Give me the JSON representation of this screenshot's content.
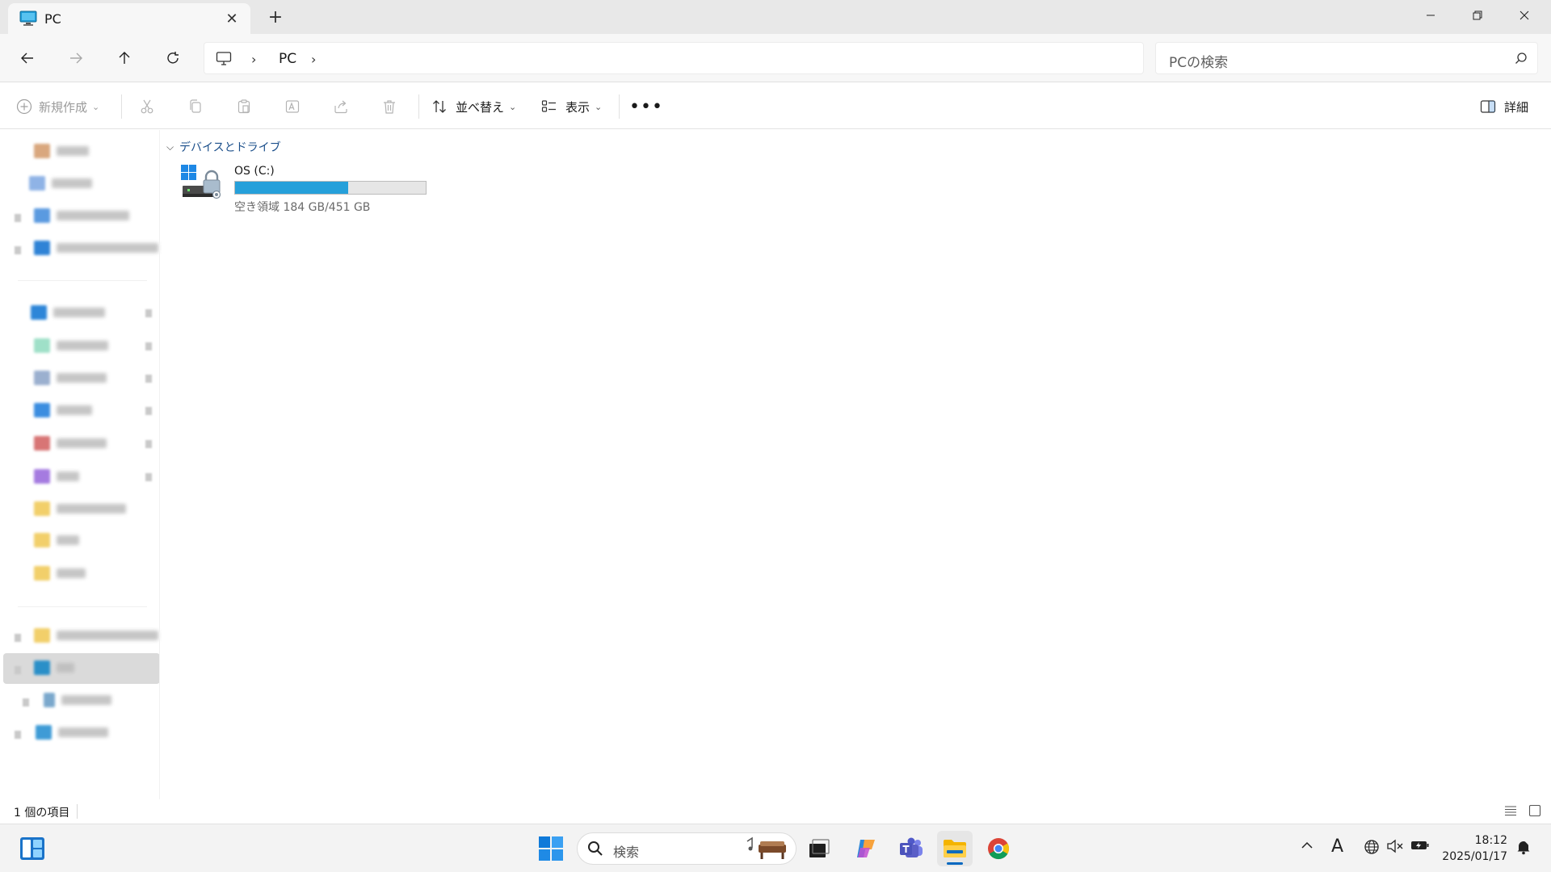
{
  "window": {
    "tab_title": "PC",
    "new_tab_glyph": "+",
    "close_tab_glyph": "✕"
  },
  "address": {
    "location_label": "PC",
    "separator": "›",
    "search_placeholder": "PCの検索"
  },
  "commandbar": {
    "new_label": "新規作成",
    "sort_label": "並べ替え",
    "view_label": "表示",
    "more_label": "•••",
    "details_label": "詳細"
  },
  "content": {
    "group_header": "デバイスとドライブ",
    "drives": [
      {
        "name": "OS (C:)",
        "space_text": "空き領域 184 GB/451 GB",
        "used_fraction": 0.592
      }
    ]
  },
  "statusbar": {
    "item_count": "1 個の項目"
  },
  "taskbar": {
    "search_label": "検索",
    "time": "18:12",
    "date": "2025/01/17",
    "ime_label": "A"
  },
  "colors": {
    "accent": "#0067c0",
    "drive_bar": "#26a0da",
    "group_header": "#1a4e8a",
    "selection": "#dadada"
  },
  "icons": {
    "tab": "pc-monitor-icon",
    "back": "arrow-left-icon",
    "forward": "arrow-right-icon",
    "up": "arrow-up-icon",
    "refresh": "refresh-icon",
    "search": "search-icon",
    "details": "details-pane-icon"
  }
}
